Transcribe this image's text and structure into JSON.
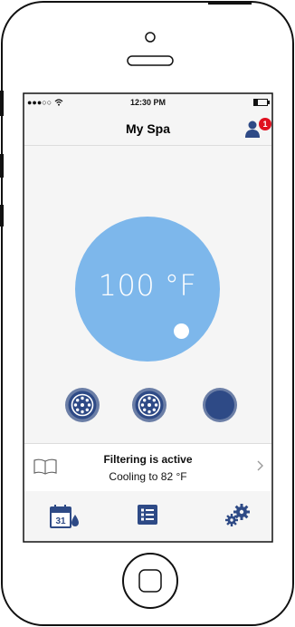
{
  "status_bar": {
    "time": "12:30 PM",
    "signal_dots": "●●●○○",
    "battery_level": 0.3
  },
  "header": {
    "title": "My Spa",
    "notification_count": "1"
  },
  "main": {
    "temperature": "100 °F",
    "temperature_value": 100
  },
  "status": {
    "line1": "Filtering is active",
    "line2": "Cooling to 82 °F"
  },
  "tabbar": {
    "items": [
      {
        "icon": "calendar-drop-icon",
        "label_number": "31"
      },
      {
        "icon": "list-icon"
      },
      {
        "icon": "gears-icon"
      }
    ]
  },
  "colors": {
    "accent": "#2e4a86",
    "dial": "#7db7eb",
    "badge": "#e0101f"
  }
}
